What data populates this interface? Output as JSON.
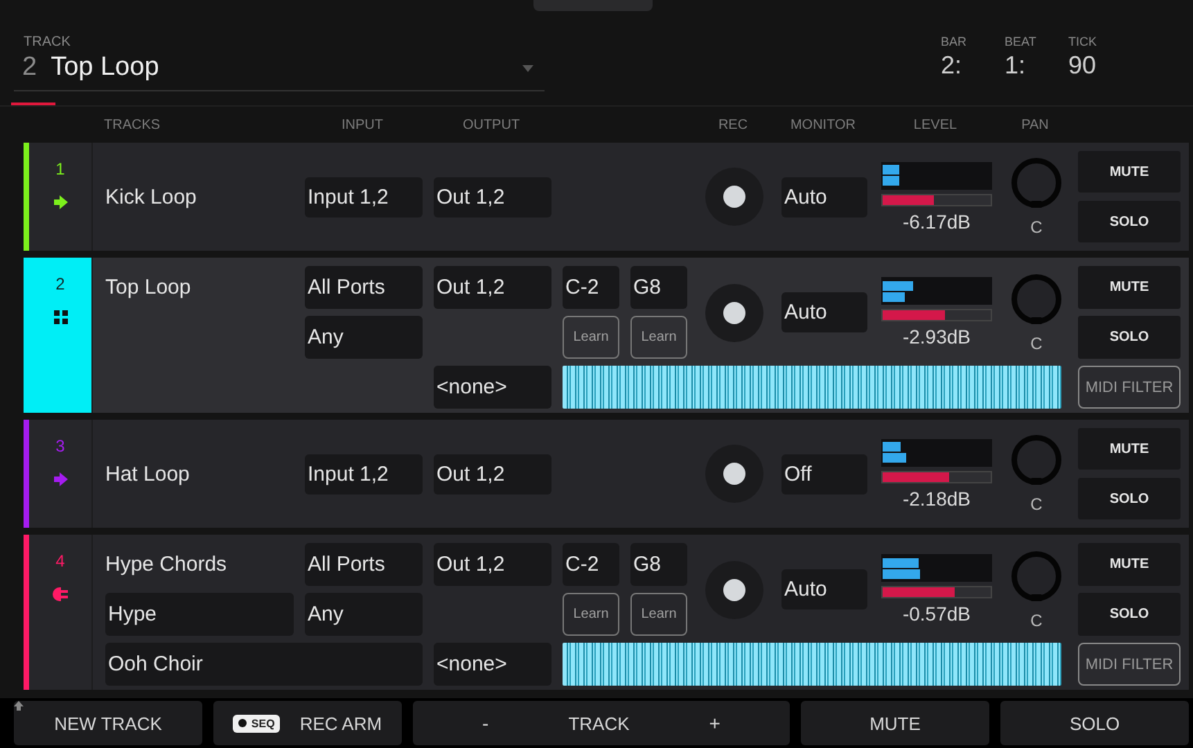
{
  "header": {
    "label": "TRACK",
    "number": "2",
    "name": "Top Loop"
  },
  "position": [
    {
      "label": "BAR",
      "value": "2:"
    },
    {
      "label": "BEAT",
      "value": "1:"
    },
    {
      "label": "TICK",
      "value": "90"
    }
  ],
  "columns": [
    {
      "label": "TRACKS",
      "kind": "name"
    },
    {
      "label": "INPUT",
      "kind": "input"
    },
    {
      "label": "OUTPUT",
      "kind": "output"
    },
    {
      "label": "REC",
      "kind": "rec"
    },
    {
      "label": "MONITOR",
      "kind": "monitor"
    },
    {
      "label": "LEVEL",
      "kind": "level"
    },
    {
      "label": "PAN",
      "kind": "pan"
    }
  ],
  "tracks": [
    {
      "number": "1",
      "name": "Kick Loop",
      "color": "#7cf01c",
      "kind": "audio",
      "selected": false,
      "input": "Input 1,2",
      "output": "Out 1,2",
      "rec_armed": false,
      "monitor": "Auto",
      "meters": [
        {
          "level": 0.16
        },
        {
          "level": 0.16
        }
      ],
      "fader": {
        "level": 0.48
      },
      "reading": "-6.17dB",
      "pan": "C",
      "mute": "MUTE",
      "solo": "SOLO"
    },
    {
      "number": "2",
      "name": "Top Loop",
      "color": "#00eef6",
      "kind": "drum",
      "selected": true,
      "input": "All Ports",
      "output": "Out 1,2",
      "rec_armed": false,
      "monitor": "Auto",
      "meters": [
        {
          "level": 0.28
        },
        {
          "level": 0.2
        }
      ],
      "fader": {
        "level": 0.58
      },
      "reading": "-2.93dB",
      "pan": "C",
      "mute": "MUTE",
      "solo": "SOLO",
      "midi": {
        "channel": "Any",
        "low_note": "C-2",
        "high_note": "G8",
        "learn_low": "Learn",
        "learn_high": "Learn",
        "program": "<none>",
        "filter": "MIDI FILTER"
      }
    },
    {
      "number": "3",
      "name": "Hat Loop",
      "color": "#a51cf0",
      "kind": "audio",
      "selected": false,
      "input": "Input 1,2",
      "output": "Out 1,2",
      "rec_armed": false,
      "monitor": "Off",
      "meters": [
        {
          "level": 0.17
        },
        {
          "level": 0.22
        }
      ],
      "fader": {
        "level": 0.61
      },
      "reading": "-2.18dB",
      "pan": "C",
      "mute": "MUTE",
      "solo": "SOLO"
    },
    {
      "number": "4",
      "name": "Hype Chords",
      "color": "#ff1a66",
      "kind": "plugin",
      "selected": false,
      "input": "All Ports",
      "output": "Out 1,2",
      "rec_armed": false,
      "monitor": "Auto",
      "meters": [
        {
          "level": 0.33
        },
        {
          "level": 0.35
        }
      ],
      "fader": {
        "level": 0.67
      },
      "reading": "-0.57dB",
      "pan": "C",
      "mute": "MUTE",
      "solo": "SOLO",
      "plugin": "Hype",
      "preset": "Ooh Choir",
      "midi": {
        "channel": "Any",
        "low_note": "C-2",
        "high_note": "G8",
        "learn_low": "Learn",
        "learn_high": "Learn",
        "program": "<none>",
        "filter": "MIDI FILTER"
      }
    }
  ],
  "footer": {
    "new_track": "NEW TRACK",
    "seq_badge": "SEQ",
    "rec_arm": "REC ARM",
    "track_prev": "-",
    "track_label": "TRACK",
    "track_next": "+",
    "mute": "MUTE",
    "solo": "SOLO"
  }
}
